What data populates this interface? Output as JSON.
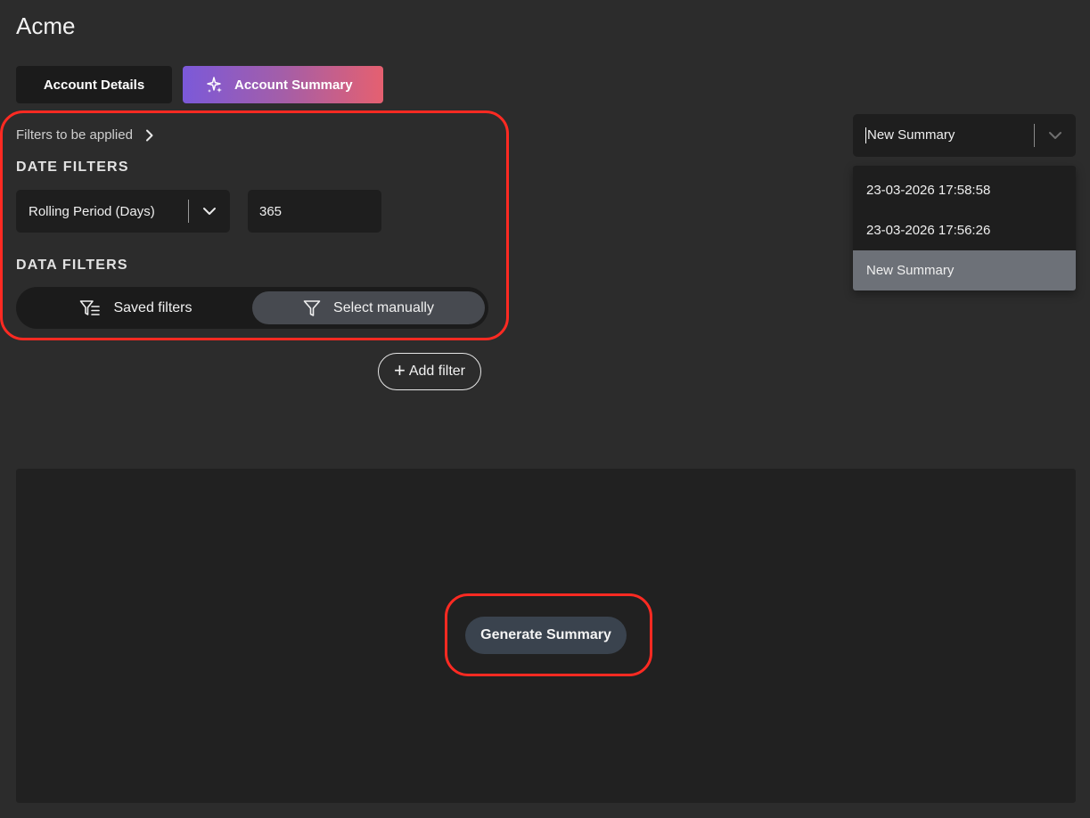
{
  "app": {
    "title": "Acme"
  },
  "tabs": [
    {
      "label": "Account Details",
      "active": false
    },
    {
      "label": "Account Summary",
      "active": true,
      "icon": "sparkle-icon"
    }
  ],
  "filters": {
    "link_label": "Filters to be applied",
    "date_heading": "DATE FILTERS",
    "period_select": {
      "value": "Rolling Period (Days)"
    },
    "period_days": "365",
    "data_heading": "DATA FILTERS",
    "modes": [
      {
        "label": "Saved filters",
        "icon": "filter-list-icon",
        "active": false
      },
      {
        "label": "Select manually",
        "icon": "filter-icon",
        "active": true
      }
    ],
    "add_filter_label": "Add filter"
  },
  "summary_select": {
    "value": "New Summary",
    "options": [
      {
        "label": "23-03-2026 17:58:58",
        "selected": false
      },
      {
        "label": "23-03-2026 17:56:26",
        "selected": false
      },
      {
        "label": "New Summary",
        "selected": true
      }
    ]
  },
  "main": {
    "generate_label": "Generate Summary"
  },
  "colors": {
    "background": "#2c2c2c",
    "panel": "#212121",
    "highlight": "#ff2a22",
    "gradient_start": "#7b59d9",
    "gradient_end": "#e56070",
    "selected_option": "#6d7178"
  }
}
